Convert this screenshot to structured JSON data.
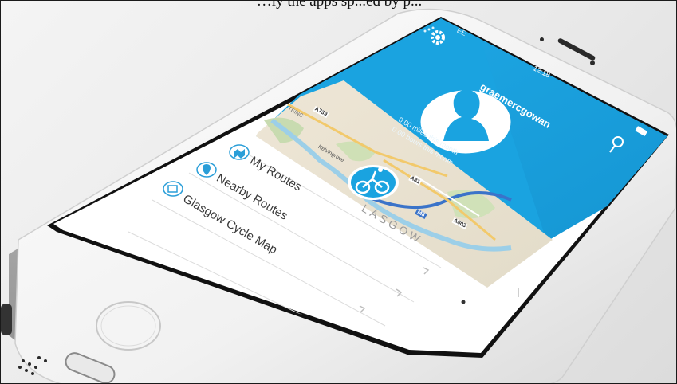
{
  "caption": "…ly the apps sp...ed by p...",
  "status_bar": {
    "carrier": "EE",
    "time": "12:18"
  },
  "profile": {
    "username": "graemercgowan",
    "miles_stat": "0.00 miles this month",
    "hours_stat": "0.00 hours this month"
  },
  "map_labels": {
    "a739": "A739",
    "a81": "A81",
    "a803": "A803",
    "m8": "M8",
    "glasgow": "LASGOW",
    "kelvingrove": "Kelvingrove",
    "teinch": "TEINC"
  },
  "menu": {
    "items": [
      {
        "label": "My Routes",
        "icon": "map-icon"
      },
      {
        "label": "Nearby Routes",
        "icon": "location-pin-icon"
      },
      {
        "label": "Glasgow Cycle Map",
        "icon": "map-grid-icon"
      }
    ]
  },
  "colors": {
    "accent": "#1aa3e0",
    "menu_icon": "#2a9ed8"
  }
}
